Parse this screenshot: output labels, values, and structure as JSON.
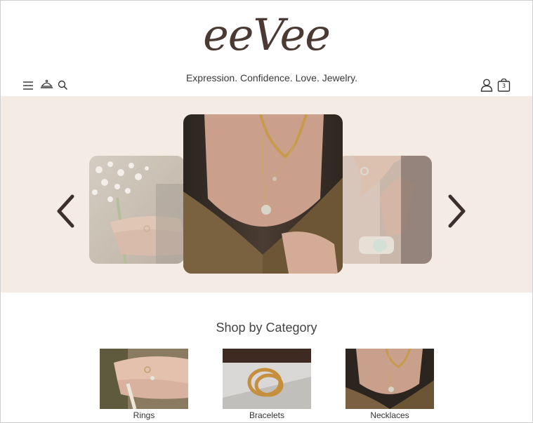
{
  "brand": {
    "logo_text": "eeVee",
    "tagline": "Expression. Confidence. Love. Jewelry."
  },
  "header": {
    "icons": [
      "menu-icon",
      "cloche-icon",
      "search-icon",
      "account-icon",
      "cart-icon"
    ],
    "cart_count": "3"
  },
  "carousel": {
    "slides": [
      {
        "name": "ring-hands-bouquet"
      },
      {
        "name": "gold-chain-necklaces"
      },
      {
        "name": "stacked-bracelets-rings"
      }
    ],
    "prev_icon": "chevron-left-icon",
    "next_icon": "chevron-right-icon"
  },
  "categories": {
    "title": "Shop by Category",
    "items": [
      {
        "label": "Rings"
      },
      {
        "label": "Bracelets"
      },
      {
        "label": "Necklaces"
      }
    ]
  },
  "colors": {
    "brand": "#4b3a33",
    "hero_bg": "#f5ebe5",
    "text": "#3a3a3a"
  }
}
